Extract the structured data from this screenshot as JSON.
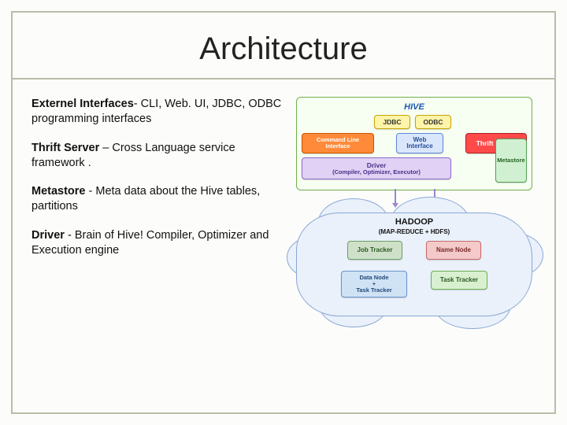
{
  "title": "Architecture",
  "bullets": {
    "b1": {
      "label": "Externel Interfaces",
      "sep": "- ",
      "desc": "CLI, Web. UI, JDBC, ODBC programming interfaces"
    },
    "b2": {
      "label": "Thrift Server",
      "sep": " – ",
      "desc": "Cross Language service framework ."
    },
    "b3": {
      "label": "Metastore",
      "sep": " -  ",
      "desc": "Meta data about the Hive tables, partitions"
    },
    "b4": {
      "label": "Driver",
      "sep": " -  ",
      "desc": "Brain of Hive! Compiler, Optimizer and Execution engine"
    }
  },
  "diagram": {
    "hive": {
      "title": "HIVE",
      "jdbc": "JDBC",
      "odbc": "ODBC",
      "cli": "Command Line Interface",
      "web": "Web Interface",
      "thrift": "Thrift Server",
      "driver_main": "Driver",
      "driver_sub": "(Compiler, Optimizer, Executor)",
      "metastore": "Metastore"
    },
    "hadoop": {
      "title": "HADOOP",
      "subtitle": "(MAP-REDUCE + HDFS)",
      "jobtracker": "Job Tracker",
      "namenode": "Name Node",
      "datanode_l1": "Data Node",
      "datanode_plus": "+",
      "datanode_l2": "Task Tracker",
      "tasktracker": "Task Tracker"
    }
  }
}
